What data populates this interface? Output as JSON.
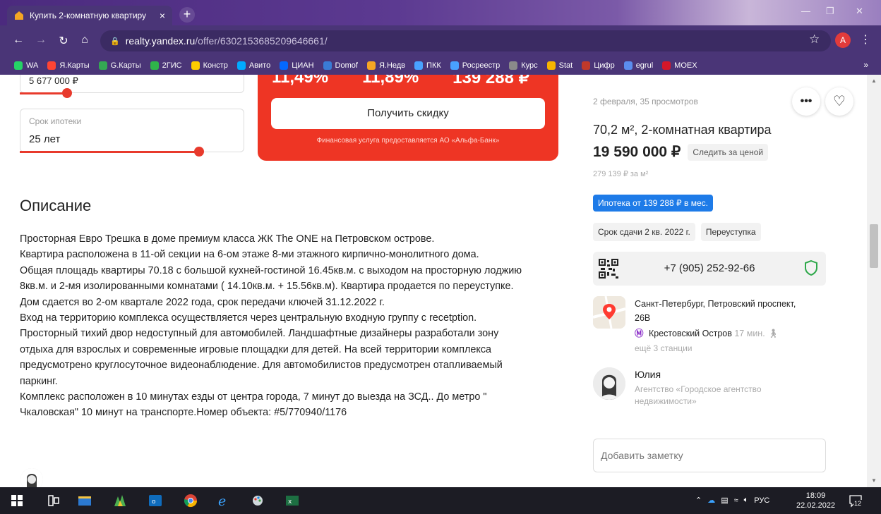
{
  "browser": {
    "tab_title": "Купить 2-комнатную квартиру",
    "tab_close": "×",
    "new_tab": "+",
    "url_host": "realty.yandex.ru",
    "url_path": "/offer/6302153685209646661/",
    "profile_initial": "A",
    "bookmarks": [
      {
        "label": "WA",
        "color": "#25d366"
      },
      {
        "label": "Я.Карты",
        "color": "#ff4433"
      },
      {
        "label": "G.Карты",
        "color": "#34a853"
      },
      {
        "label": "2ГИС",
        "color": "#2fb34a"
      },
      {
        "label": "Констр",
        "color": "#ffcc00"
      },
      {
        "label": "Авито",
        "color": "#00aaff"
      },
      {
        "label": "ЦИАН",
        "color": "#0468ff"
      },
      {
        "label": "Domof",
        "color": "#3a7bd5"
      },
      {
        "label": "Я.Недв",
        "color": "#f5a623"
      },
      {
        "label": "ПКК",
        "color": "#49a1ff"
      },
      {
        "label": "Росреестр",
        "color": "#49a1ff"
      },
      {
        "label": "Курс",
        "color": "#8a8a8a"
      },
      {
        "label": "Stat",
        "color": "#f6b400"
      },
      {
        "label": "Цифр",
        "color": "#c0392b"
      },
      {
        "label": "egrul",
        "color": "#5b8def"
      },
      {
        "label": "MOEX",
        "color": "#d4172a"
      }
    ],
    "bookmarks_more": "»"
  },
  "calculator": {
    "price_value_partial": "5 677 000 ₽",
    "term_label": "Срок ипотеки",
    "term_value": "25 лет",
    "rates_partial": [
      "11,49%",
      "11,89%",
      "139 288 ₽"
    ],
    "discount_button": "Получить скидку",
    "bank_note": "Финансовая услуга предоставляется АО «Альфа-Банк»"
  },
  "description": {
    "title": "Описание",
    "lines": [
      "Просторная Евро Трешка в доме премиум класса ЖК The ONE на Петровском острове.",
      "Квартира расположена в 11-ой секции на 6-ом этаже 8-ми этажного кирпично-монолитного дома.",
      "Общая площадь квартиры 70.18 с большой кухней-гостиной 16.45кв.м. с выходом на просторную лоджию",
      "8кв.м. и 2-мя изолированными комнатами ( 14.10кв.м. + 15.56кв.м). Квартира продается по переуступке.",
      "Дом сдается во 2-ом квартале 2022 года, срок передачи ключей 31.12.2022 г.",
      "Вход на территорию комплекса осуществляется через центральную входную группу с recetption.",
      "Просторный тихий двор недоступный для автомобилей. Ландшафтные дизайнеры разработали зону",
      "отдыха для взрослых и современные игровые площадки для детей. На всей территории комплекса",
      "предусмотрено круглосуточное видеонаблюдение. Для автомобилистов предусмотрен отапливаемый",
      "паркинг.",
      "Комплекс расположен в 10 минутах езды от центра города, 7 минут до выезда на ЗСД.. До метро \"",
      "Чкаловская\" 10 минут на транспорте.Номер объекта: #5/770940/1176"
    ]
  },
  "offer": {
    "meta": "2 февраля, 35 просмотров",
    "more_button": "•••",
    "favorite_button": "♡",
    "heading": "70,2 м², 2-комнатная квартира",
    "price": "19 590 000 ₽",
    "watch_price": "Следить за ценой",
    "price_per_m2": "279 139 ₽ за м²",
    "mortgage_badge": "Ипотека от 139 288 ₽ в мес.",
    "chips": [
      "Срок сдачи 2 кв. 2022 г.",
      "Переуступка"
    ],
    "phone": "+7 (905) 252-92-66",
    "address": "Санкт-Петербург, Петровский проспект, 26В",
    "metro_symbol": "Ⓜ",
    "metro_station": "Крестовский Остров",
    "metro_time": "17 мин.",
    "more_stations": "ещё 3 станции",
    "agent_name": "Юлия",
    "agency": "Агентство «Городское агентство недвижимости»",
    "note_placeholder": "Добавить заметку"
  },
  "taskbar": {
    "tray_lang": "РУС",
    "time": "18:09",
    "date": "22.02.2022",
    "notifications": "12"
  },
  "colors": {
    "accent_red": "#ee3524",
    "mortgage_blue": "#1e7be8",
    "browser_purple": "#4a3577"
  }
}
